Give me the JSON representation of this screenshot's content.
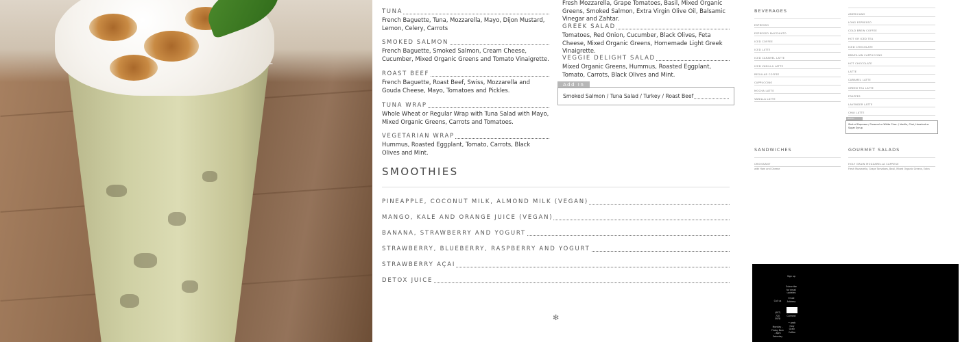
{
  "left_menu": [
    {
      "title": "Tuna",
      "desc": "French Baguette, Tuna, Mozzarella, Mayo, Dijon Mustard, Lemon, Celery, Carrots"
    },
    {
      "title": "Smoked Salmon",
      "desc": "French Baguette, Smoked Salmon, Cream Cheese, Cucumber, Mixed Organic Greens and Tomato Vinaigrette."
    },
    {
      "title": "Roast Beef",
      "desc": "French Baguette, Roast Beef, Swiss, Mozzarella and Gouda Cheese, Mayo, Tomatoes and Pickles."
    },
    {
      "title": "Tuna Wrap",
      "desc": "Whole Wheat or Regular Wrap with Tuna Salad with Mayo, Mixed Organic Greens, Carrots and Tomatoes."
    },
    {
      "title": "Vegetarian Wrap",
      "desc": "Hummus, Roasted Eggplant, Tomato, Carrots, Black Olives and Mint."
    }
  ],
  "right_menu": [
    {
      "title": "",
      "desc": "Fresh Mozzarella, Grape Tomatoes, Basil, Mixed Organic Greens, Smoked Salmon, Extra Virgin Olive Oil, Balsamic Vinegar and Zahtar."
    },
    {
      "title": "Greek Salad",
      "desc": "Tomatoes, Red Onion, Cucumber, Black Olives, Feta Cheese, Mixed Organic Greens, Homemade Light Greek Vinaigrette."
    },
    {
      "title": "Veggie Delight Salad",
      "desc": "Mixed Organic Greens, Hummus, Roasted Eggplant, Tomato, Carrots, Black Olives and Mint."
    }
  ],
  "add_in": {
    "label": "Add In",
    "items": "Smoked Salmon / Tuna Salad / Turkey / Roast Beef"
  },
  "smoothies": {
    "title": "Smoothies",
    "items": [
      "Pineapple, Coconut Milk, Almond Milk (Vegan)",
      "Mango, Kale and Orange Juice (Vegan)",
      "Banana, Strawberry and Yogurt",
      "Strawberry, Blueberry, Raspberry and Yogurt",
      "Strawberry Açaí",
      "Detox Juice"
    ]
  },
  "decor": {
    "star": "✻"
  },
  "thumbnail": {
    "beverages_title": "Beverages",
    "beverages_items": [
      "Espresso",
      "Espresso Macchiato",
      "Iced Coffee",
      "Iced Latte",
      "Iced Caramel Latte",
      "Iced Vanilla Latte",
      "Regular Coffee",
      "Cappuccino",
      "Mocha Latte",
      "Vanilla Latte"
    ],
    "right_col_items": [
      "Americano",
      "Long Espresso",
      "Cold Brew Coffee",
      "Hot or Iced Tea",
      "Iced Chocolate",
      "Brazilian Cappuccino",
      "Hot Chocolate",
      "Latte",
      "Caramel Latte",
      "Green Tea Latte",
      "Frappes",
      "Lavender Latte",
      "Chai Latte"
    ],
    "addin_tag": "Add In",
    "addin_text": "Shot of Espresso / Caramel or White Choc. / Vanilla, Chai, Hazelnut or Sugar Syrup",
    "sandwiches_title": "Sandwiches",
    "sandwiches_first": "Croissant",
    "sandwiches_first_desc": "with Ham and Cheese",
    "salads_title": "Gourmet Salads",
    "salads_first": "Holy Grain Mozzarella Caprese",
    "salads_first_desc": "Fresh Mozzarella, Grape Tomatoes, Basil, Mixed Organic Greens, Extra",
    "footer_sign_up": "Sign up",
    "footer_subscribe": "Subscribe for email updates",
    "footer_email": "Email Address",
    "footer_connect": "Connect",
    "footer_call_us": "Call us",
    "footer_phone": "(407) 720 5978",
    "footer_hours": "Monday - Friday 8am - 8pm Saturday",
    "footer_right": "• grab Holy Grain Coffee"
  }
}
